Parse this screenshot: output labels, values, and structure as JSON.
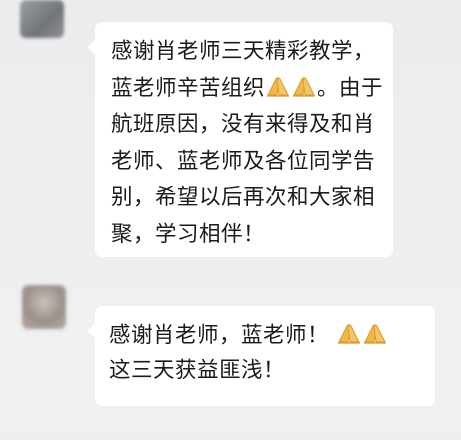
{
  "messages": [
    {
      "sender": "",
      "lines": [
        "感谢肖老师三天精彩教学，",
        "蓝老师辛苦组织",
        "。由于",
        "航班原因，没有来得及和肖",
        "老师、蓝老师及各位同学告",
        "别，希望以后再次和大家相",
        "聚，学习相伴！"
      ],
      "emoji": [
        "folded-hands-icon",
        "folded-hands-icon"
      ]
    },
    {
      "sender": "",
      "lines": [
        "感谢肖老师，蓝老师！",
        "这三天获益匪浅！"
      ],
      "emoji": [
        "folded-hands-icon",
        "folded-hands-icon"
      ]
    }
  ],
  "colors": {
    "background": "#efeff0",
    "bubble": "#ffffff",
    "text": "#1b1b1b",
    "emoji": "#f2b64a"
  }
}
